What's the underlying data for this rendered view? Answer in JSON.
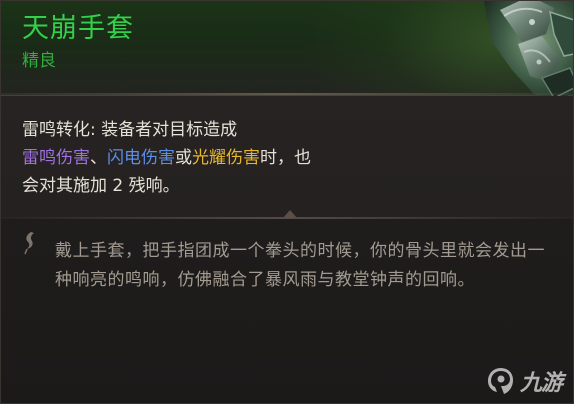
{
  "item": {
    "name": "天崩手套",
    "rarity": "精良"
  },
  "effect": {
    "label": "雷鸣转化:",
    "text_1": "装备者对目标造成",
    "damage_thunder": "雷鸣伤害",
    "sep_1": "、",
    "damage_lightning": "闪电伤害",
    "sep_2": "或",
    "damage_radiant": "光耀伤害",
    "text_2": "时，也",
    "text_3": "会对其施加 2 残响。"
  },
  "flavor": {
    "text": "戴上手套，把手指团成一个拳头的时候，你的骨头里就会发出一种响亮的鸣响，仿佛融合了暴风雨与教堂钟声的回响。"
  },
  "watermark": {
    "text": "九游"
  },
  "colors": {
    "name_green": "#34d04a",
    "thunder_purple": "#9e72e0",
    "lightning_blue": "#5b8fe8",
    "radiant_gold": "#e8b62c"
  },
  "icons": {
    "flavor": "quill-icon",
    "item": "gauntlet-icon",
    "watermark": "nine-game-logo-icon"
  }
}
